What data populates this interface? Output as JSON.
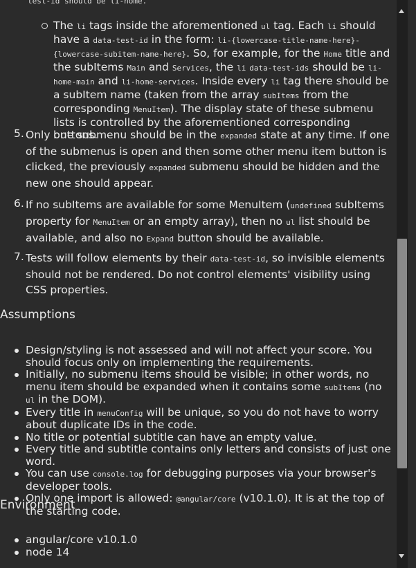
{
  "clipped_top_text": "test-id should be li-home.",
  "sub_item": {
    "p1": "The ",
    "c1": "li",
    "p2": " tags inside the aforementioned ",
    "c2": "ul",
    "p3": " tag. Each ",
    "c3": "li",
    "p4": " should have a ",
    "c4": "data-test-id",
    "p5": " in the form: ",
    "c5": "li-{lowercase-title-name-here}-{lowercase-subitem-name-here}",
    "p6": ". So, for example, for the ",
    "c6": "Home",
    "p7": " title and the subItems ",
    "c7": "Main",
    "p8": " and ",
    "c8": "Services",
    "p9": ", the ",
    "c9": "li",
    "p10": " ",
    "c10": "data-test-ids",
    "p11": " should be ",
    "c11": "li-home-main",
    "p12": " and ",
    "c12": "li-home-services",
    "p13": ". Inside every ",
    "c13": "li",
    "p14": " tag there should be a subItem name (taken from the array ",
    "c14": "subItems",
    "p15": " from the corresponding ",
    "c15": "MenuItem",
    "p16": "). The display state of these submenu lists is controlled by the aforementioned corresponding buttons."
  },
  "items": [
    {
      "num": "5.",
      "p1": "Only one submenu should be in the ",
      "c1": "expanded",
      "p2": " state at any time. If one of the submenus is open and then some other menu item button is clicked, the previously ",
      "c2": "expanded",
      "p3": " submenu should be hidden and the new one should appear."
    },
    {
      "num": "6.",
      "p1": "If no subItems are available for some MenuItem (",
      "c1": "undefined",
      "p2": " subItems property for ",
      "c2": "MenuItem",
      "p3": " or an empty array), then no ",
      "c3": "ul",
      "p4": " list should be available, and also no ",
      "c4": "Expand",
      "p5": " button should be available."
    },
    {
      "num": "7.",
      "p1": "Tests will follow elements by their ",
      "c1": "data-test-id",
      "p2": ", so invisible elements should not be rendered. Do not control elements' visibility using CSS properties."
    }
  ],
  "assumptions_heading": "Assumptions",
  "assumptions": [
    {
      "p1": "Design/styling is not assessed and will not affect your score. You should focus only on implementing the requirements."
    },
    {
      "p1": "Initially, no submenu items should be visible; in other words, no menu item should be expanded when it contains some ",
      "c1": "subItems",
      "p2": " (no ",
      "c2": "ul",
      "p3": " in the DOM)."
    },
    {
      "p1": "Every title in ",
      "c1": "menuConfig",
      "p2": " will be unique, so you do not have to worry about duplicate IDs in the code."
    },
    {
      "p1": "No title or potential subtitle can have an empty value."
    },
    {
      "p1": "Every title and subtitle contains only letters and consists of just one word."
    },
    {
      "p1": "You can use ",
      "c1": "console.log",
      "p2": " for debugging purposes via your browser's developer tools."
    },
    {
      "p1": "Only one import is allowed: ",
      "c1": "@angular/core",
      "p2": " (v10.1.0). It is at the top of the starting code."
    }
  ],
  "environment_heading": "Environment",
  "environment": [
    {
      "p1": "angular/core v10.1.0"
    },
    {
      "p1": "node 14"
    }
  ],
  "scrollbar": {
    "up_icon": "arrow-up",
    "down_icon": "arrow-down",
    "position_fraction": 0.42
  }
}
